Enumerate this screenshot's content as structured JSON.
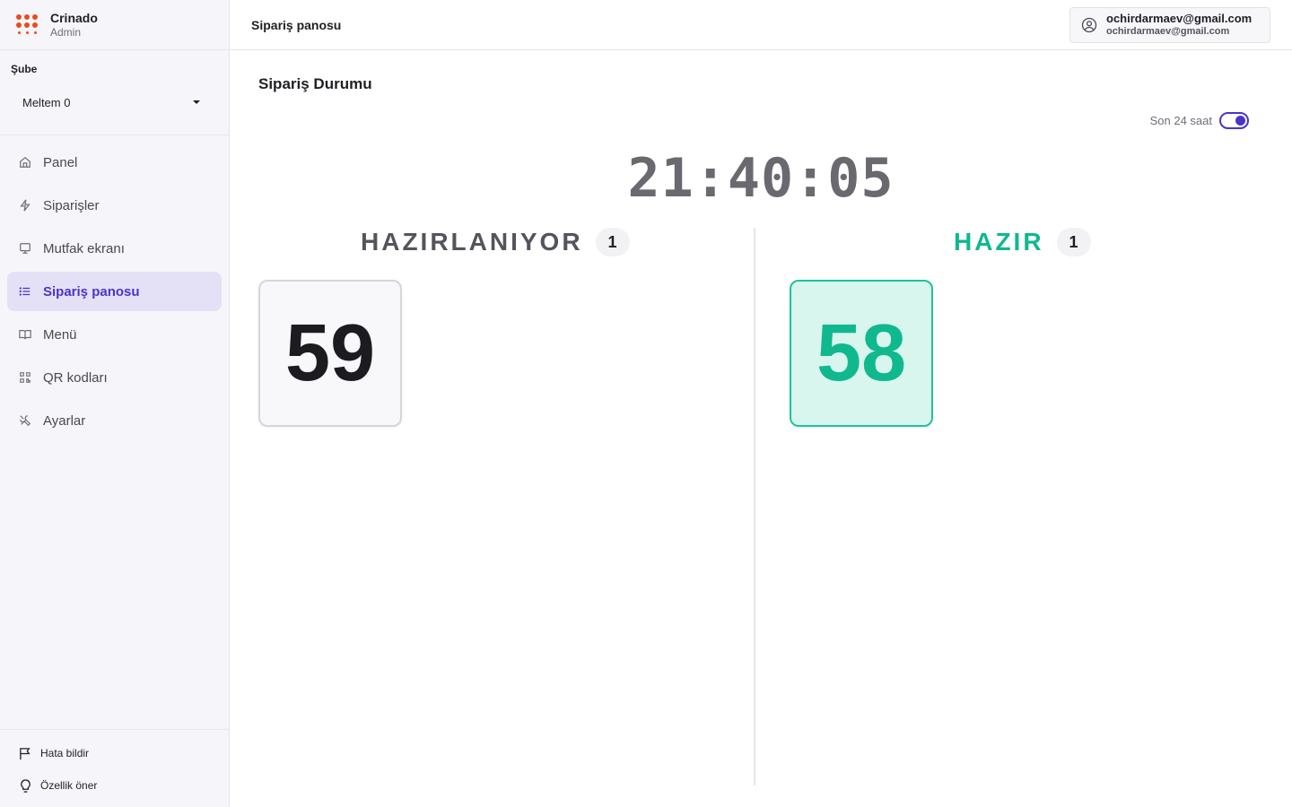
{
  "brand": {
    "name": "Crinado",
    "role": "Admin"
  },
  "branch": {
    "label": "Şube",
    "selected": "Meltem 0"
  },
  "nav": [
    {
      "label": "Panel",
      "icon": "home-icon"
    },
    {
      "label": "Siparişler",
      "icon": "bolt-icon"
    },
    {
      "label": "Mutfak ekranı",
      "icon": "monitor-icon"
    },
    {
      "label": "Sipariş panosu",
      "icon": "list-icon",
      "active": true
    },
    {
      "label": "Menü",
      "icon": "book-icon"
    },
    {
      "label": "QR kodları",
      "icon": "qr-icon"
    },
    {
      "label": "Ayarlar",
      "icon": "tools-icon"
    }
  ],
  "footer": {
    "report": "Hata bildir",
    "suggest": "Özellik öner"
  },
  "topbar": {
    "title": "Sipariş panosu"
  },
  "user": {
    "email": "ochirdarmaev@gmail.com",
    "sub": "ochirdarmaev@gmail.com"
  },
  "board": {
    "title": "Sipariş Durumu",
    "toggle_label": "Son 24 saat",
    "toggle_on": true,
    "clock": "21:40:05",
    "preparing": {
      "title": "HAZIRLANIYOR",
      "count": "1",
      "orders": [
        "59"
      ]
    },
    "ready": {
      "title": "HAZIR",
      "count": "1",
      "orders": [
        "58"
      ]
    }
  },
  "colors": {
    "accent": "#4a34c8",
    "ready": "#10b88e",
    "brand": "#ec4a1c"
  }
}
